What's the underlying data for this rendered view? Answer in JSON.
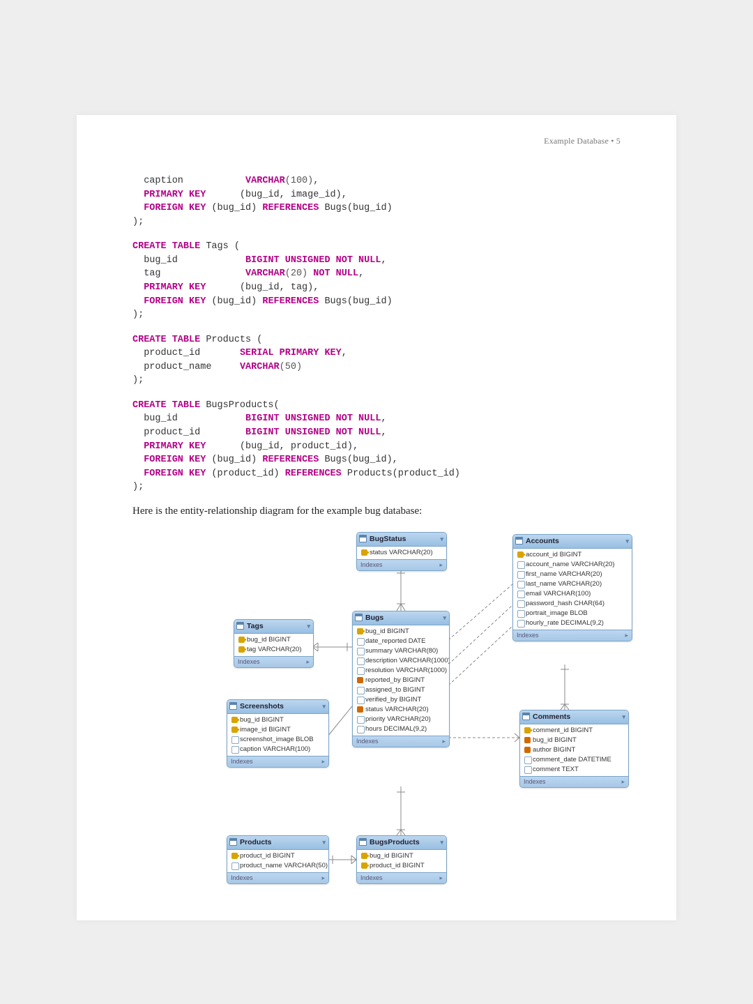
{
  "header": {
    "running_head": "Example Database • 5"
  },
  "sql": {
    "block1": {
      "l1_a": "  caption           ",
      "l1_b": "VARCHAR",
      "l1_c": "(100)",
      "l1_d": ",",
      "l2_a": "  ",
      "l2_b": "PRIMARY KEY",
      "l2_c": "      (bug_id, image_id),",
      "l3_a": "  ",
      "l3_b": "FOREIGN KEY",
      "l3_c": " (bug_id) ",
      "l3_d": "REFERENCES",
      "l3_e": " Bugs(bug_id)",
      "l4": ");"
    },
    "tags": {
      "h_a": "CREATE TABLE",
      "h_b": " Tags (",
      "l1_a": "  bug_id            ",
      "l1_b": "BIGINT UNSIGNED NOT NULL",
      "l1_c": ",",
      "l2_a": "  tag               ",
      "l2_b": "VARCHAR",
      "l2_c": "(20)",
      "l2_d": " NOT NULL",
      "l2_e": ",",
      "l3_a": "  ",
      "l3_b": "PRIMARY KEY",
      "l3_c": "      (bug_id, tag),",
      "l4_a": "  ",
      "l4_b": "FOREIGN KEY",
      "l4_c": " (bug_id) ",
      "l4_d": "REFERENCES",
      "l4_e": " Bugs(bug_id)",
      "end": ");"
    },
    "products": {
      "h_a": "CREATE TABLE",
      "h_b": " Products (",
      "l1_a": "  product_id       ",
      "l1_b": "SERIAL PRIMARY KEY",
      "l1_c": ",",
      "l2_a": "  product_name     ",
      "l2_b": "VARCHAR",
      "l2_c": "(50)",
      "end": ");"
    },
    "bp": {
      "h_a": "CREATE TABLE",
      "h_b": " BugsProducts(",
      "l1_a": "  bug_id            ",
      "l1_b": "BIGINT UNSIGNED NOT NULL",
      "l1_c": ",",
      "l2_a": "  product_id        ",
      "l2_b": "BIGINT UNSIGNED NOT NULL",
      "l2_c": ",",
      "l3_a": "  ",
      "l3_b": "PRIMARY KEY",
      "l3_c": "      (bug_id, product_id),",
      "l4_a": "  ",
      "l4_b": "FOREIGN KEY",
      "l4_c": " (bug_id) ",
      "l4_d": "REFERENCES",
      "l4_e": " Bugs(bug_id),",
      "l5_a": "  ",
      "l5_b": "FOREIGN KEY",
      "l5_c": " (product_id) ",
      "l5_d": "REFERENCES",
      "l5_e": " Products(product_id)",
      "end": ");"
    }
  },
  "caption": "Here is the entity-relationship diagram for the example bug database:",
  "er": {
    "idx_label": "Indexes",
    "chev": "▾",
    "arrow": "▸",
    "tables": {
      "bugstatus": {
        "title": "BugStatus",
        "cols": [
          {
            "k": "pk",
            "txt": "status VARCHAR(20)"
          }
        ]
      },
      "accounts": {
        "title": "Accounts",
        "cols": [
          {
            "k": "pk",
            "txt": "account_id BIGINT"
          },
          {
            "k": "col",
            "txt": "account_name VARCHAR(20)"
          },
          {
            "k": "col",
            "txt": "first_name VARCHAR(20)"
          },
          {
            "k": "col",
            "txt": "last_name VARCHAR(20)"
          },
          {
            "k": "col",
            "txt": "email VARCHAR(100)"
          },
          {
            "k": "col",
            "txt": "password_hash CHAR(64)"
          },
          {
            "k": "col",
            "txt": "portrait_image BLOB"
          },
          {
            "k": "col",
            "txt": "hourly_rate DECIMAL(9,2)"
          }
        ]
      },
      "tags": {
        "title": "Tags",
        "cols": [
          {
            "k": "pk",
            "txt": "bug_id BIGINT"
          },
          {
            "k": "pk",
            "txt": "tag VARCHAR(20)"
          }
        ]
      },
      "bugs": {
        "title": "Bugs",
        "cols": [
          {
            "k": "pk",
            "txt": "bug_id BIGINT"
          },
          {
            "k": "col",
            "txt": "date_reported DATE"
          },
          {
            "k": "col",
            "txt": "summary VARCHAR(80)"
          },
          {
            "k": "col",
            "txt": "description VARCHAR(1000)"
          },
          {
            "k": "col",
            "txt": "resolution VARCHAR(1000)"
          },
          {
            "k": "fk",
            "txt": "reported_by BIGINT"
          },
          {
            "k": "col",
            "txt": "assigned_to BIGINT"
          },
          {
            "k": "col",
            "txt": "verified_by BIGINT"
          },
          {
            "k": "fk",
            "txt": "status VARCHAR(20)"
          },
          {
            "k": "col",
            "txt": "priority VARCHAR(20)"
          },
          {
            "k": "col",
            "txt": "hours DECIMAL(9,2)"
          }
        ]
      },
      "screenshots": {
        "title": "Screenshots",
        "cols": [
          {
            "k": "pk",
            "txt": "bug_id BIGINT"
          },
          {
            "k": "pk",
            "txt": "image_id BIGINT"
          },
          {
            "k": "col",
            "txt": "screenshot_image BLOB"
          },
          {
            "k": "col",
            "txt": "caption VARCHAR(100)"
          }
        ]
      },
      "comments": {
        "title": "Comments",
        "cols": [
          {
            "k": "pk",
            "txt": "comment_id BIGINT"
          },
          {
            "k": "fk",
            "txt": "bug_id BIGINT"
          },
          {
            "k": "fk",
            "txt": "author BIGINT"
          },
          {
            "k": "col",
            "txt": "comment_date DATETIME"
          },
          {
            "k": "col",
            "txt": "comment TEXT"
          }
        ]
      },
      "products": {
        "title": "Products",
        "cols": [
          {
            "k": "pk",
            "txt": "product_id BIGINT"
          },
          {
            "k": "col",
            "txt": "product_name VARCHAR(50)"
          }
        ]
      },
      "bugsproducts": {
        "title": "BugsProducts",
        "cols": [
          {
            "k": "pk",
            "txt": "bug_id BIGINT"
          },
          {
            "k": "pk",
            "txt": "product_id BIGINT"
          }
        ]
      }
    }
  }
}
